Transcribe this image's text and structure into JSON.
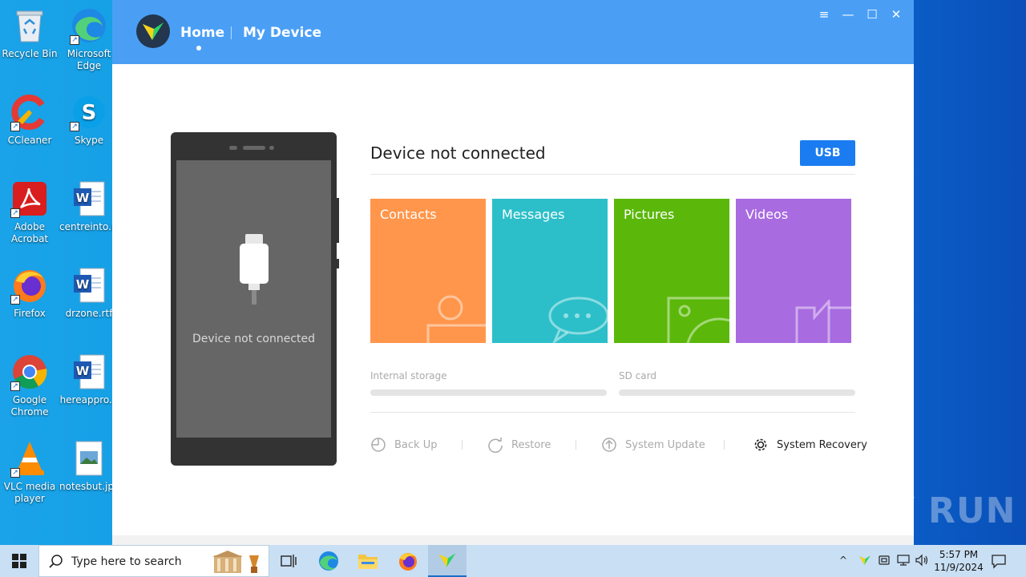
{
  "desktop": {
    "icons": [
      {
        "label": "Recycle Bin",
        "icon": "recycle-bin-icon"
      },
      {
        "label": "Microsoft Edge",
        "icon": "edge-icon"
      },
      {
        "label": "CCleaner",
        "icon": "ccleaner-icon"
      },
      {
        "label": "Skype",
        "icon": "skype-icon"
      },
      {
        "label": "Adobe Acrobat",
        "icon": "acrobat-icon"
      },
      {
        "label": "centreinto.rtf",
        "icon": "word-doc-icon"
      },
      {
        "label": "Firefox",
        "icon": "firefox-icon"
      },
      {
        "label": "drzone.rtf",
        "icon": "word-doc-icon"
      },
      {
        "label": "Google Chrome",
        "icon": "chrome-icon"
      },
      {
        "label": "hereappro...",
        "icon": "word-doc-icon"
      },
      {
        "label": "VLC media player",
        "icon": "vlc-icon"
      },
      {
        "label": "notesbut.jpg",
        "icon": "image-file-icon"
      }
    ]
  },
  "app": {
    "nav": {
      "home": "Home",
      "my_device": "My Device"
    },
    "window_controls": [
      "menu-icon",
      "minimize-icon",
      "maximize-icon",
      "close-icon"
    ],
    "phone": {
      "message": "Device not connected"
    },
    "status_title": "Device not connected",
    "connection_button": "USB",
    "tiles": [
      {
        "label": "Contacts",
        "color": "#ff964b"
      },
      {
        "label": "Messages",
        "color": "#2cbfc9"
      },
      {
        "label": "Pictures",
        "color": "#5bb80a"
      },
      {
        "label": "Videos",
        "color": "#a86be0"
      }
    ],
    "storage": {
      "internal": "Internal storage",
      "sd": "SD card"
    },
    "actions": [
      {
        "label": "Back Up",
        "enabled": false
      },
      {
        "label": "Restore",
        "enabled": false
      },
      {
        "label": "System Update",
        "enabled": false
      },
      {
        "label": "System Recovery",
        "enabled": true
      }
    ],
    "accent": "#4a9ff5"
  },
  "watermark": "ANY RUN",
  "taskbar": {
    "search_placeholder": "Type here to search",
    "time": "5:57 PM",
    "date": "11/9/2024"
  }
}
